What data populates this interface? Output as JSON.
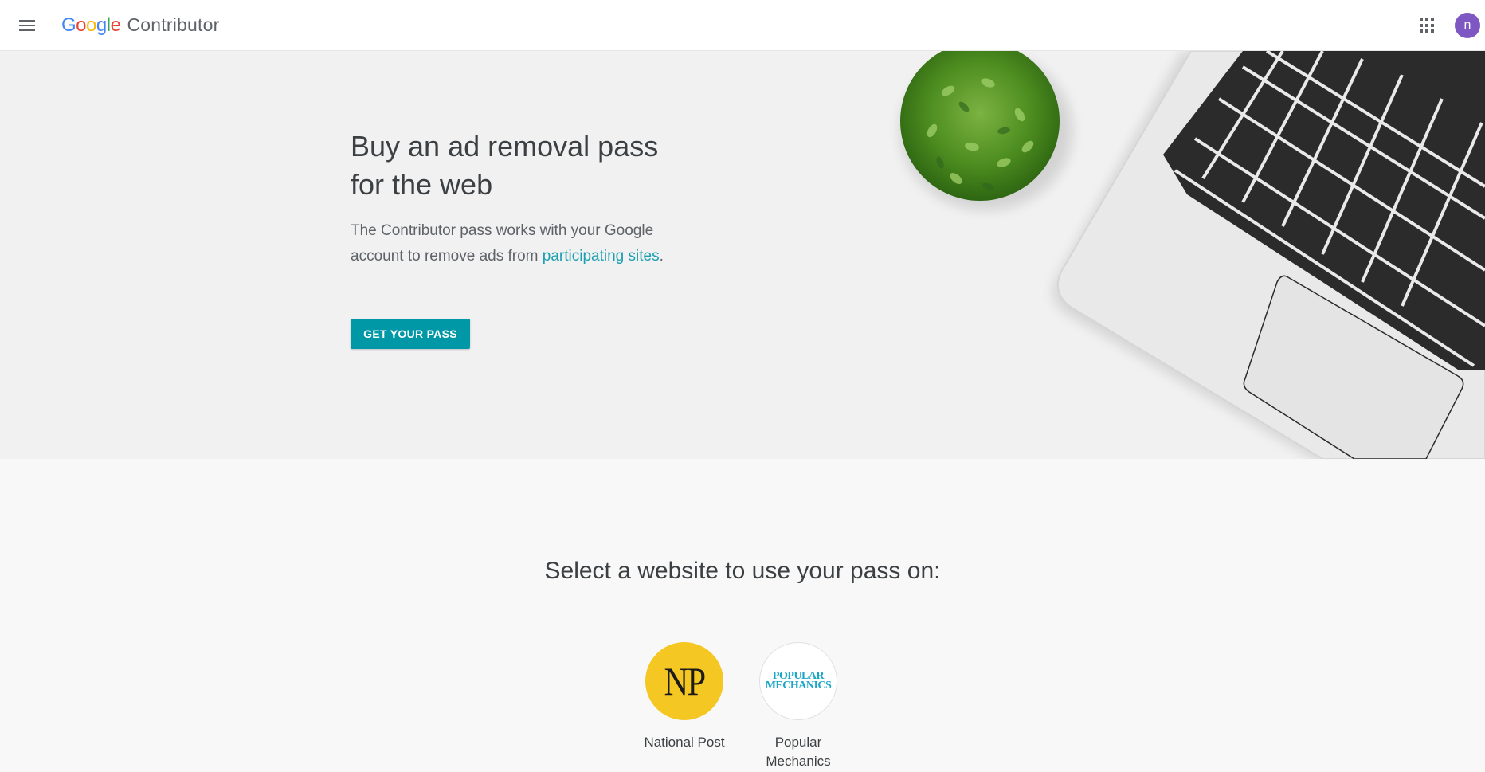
{
  "header": {
    "menu_icon": "hamburger-menu-icon",
    "logo_google": "Google",
    "logo_product": "Contributor",
    "apps_icon": "apps-grid-icon",
    "avatar_initial": "n",
    "avatar_color": "#7e57c2"
  },
  "hero": {
    "title": "Buy an ad removal pass for the web",
    "description_prefix": "The Contributor pass works with your Google account to remove ads from ",
    "description_link": "participating sites",
    "description_suffix": ".",
    "cta_label": "GET YOUR PASS",
    "accent_color": "#0097a7"
  },
  "sites": {
    "title": "Select a website to use your pass on:",
    "items": [
      {
        "name": "National Post",
        "logo_text": "NP",
        "logo_color": "#f5c722"
      },
      {
        "name": "Popular Mechanics",
        "logo_line1": "POPULAR",
        "logo_line2": "MECHANICS",
        "logo_color": "#1aa6c8"
      }
    ]
  }
}
